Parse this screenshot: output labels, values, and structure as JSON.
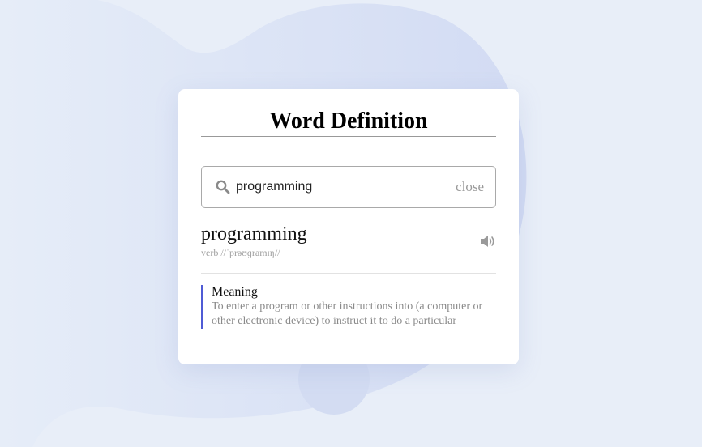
{
  "app": {
    "title": "Word Definition"
  },
  "search": {
    "value": "programming",
    "icon": "search-icon",
    "close_label": "close"
  },
  "result": {
    "word": "programming",
    "part_of_speech": "verb",
    "phonetic": "//ˈprəʊɡramɪŋ//",
    "phonetic_line": "verb //ˈprəʊɡramɪŋ//",
    "speaker_icon": "speaker-icon"
  },
  "meaning": {
    "label": "Meaning",
    "text": "To enter a program or other instructions into (a computer or other electronic device) to instruct it to do a particular"
  },
  "colors": {
    "background": "#e8eef8",
    "accent": "#4f5bd5",
    "blob": "#d3dcf3"
  }
}
